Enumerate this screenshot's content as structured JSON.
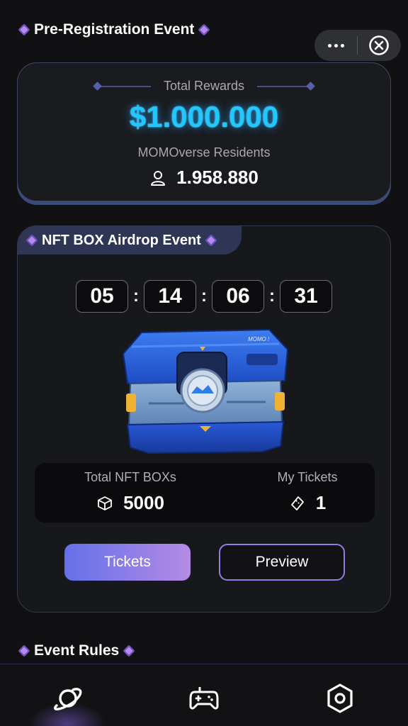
{
  "header": {
    "title": "Pre-Registration Event"
  },
  "capsule": {
    "more_icon": "more-dots-icon",
    "close_icon": "close-circle-icon"
  },
  "rewards": {
    "label": "Total Rewards",
    "value": "$1.000.000",
    "residents_label": "MOMOverse Residents",
    "residents_count": "1.958.880",
    "accent_color": "#21c8ff"
  },
  "nft_event": {
    "title": "NFT BOX Airdrop Event",
    "countdown": [
      "05",
      "14",
      "06",
      "31"
    ],
    "chest_logo": "MOMO !",
    "total_boxes_label": "Total NFT BOXs",
    "total_boxes_value": "5000",
    "my_tickets_label": "My Tickets",
    "my_tickets_value": "1",
    "tickets_button": "Tickets",
    "preview_button": "Preview"
  },
  "rules": {
    "title": "Event Rules"
  },
  "nav": {
    "items": [
      {
        "icon": "planet-icon",
        "active": true
      },
      {
        "icon": "gamepad-icon",
        "active": false
      },
      {
        "icon": "hexagon-settings-icon",
        "active": false
      }
    ]
  }
}
